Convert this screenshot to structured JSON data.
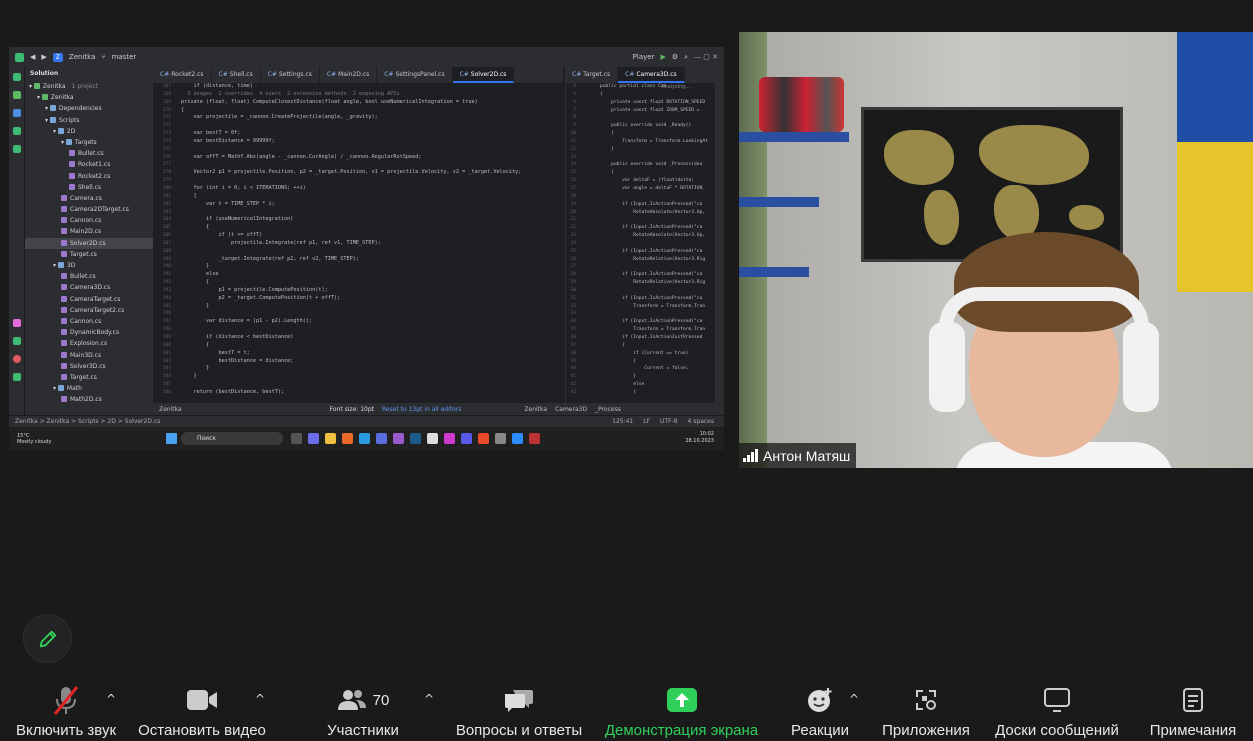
{
  "ide": {
    "project": "Zenitka",
    "branch": "master",
    "run_config": "Player",
    "solution_title": "Solution",
    "tree": [
      {
        "label": "Zenitka",
        "note": "1 project",
        "indent": 0,
        "type": "proj"
      },
      {
        "label": "Zenitka",
        "note": "",
        "indent": 1,
        "type": "proj"
      },
      {
        "label": "Dependencies",
        "note": "",
        "indent": 2,
        "type": "folder"
      },
      {
        "label": "Scripts",
        "note": "",
        "indent": 2,
        "type": "folder"
      },
      {
        "label": "2D",
        "note": "",
        "indent": 3,
        "type": "folder"
      },
      {
        "label": "Targets",
        "note": "",
        "indent": 4,
        "type": "folder"
      },
      {
        "label": "Bullet.cs",
        "note": "",
        "indent": 5,
        "type": "cs"
      },
      {
        "label": "Rocket1.cs",
        "note": "",
        "indent": 5,
        "type": "cs"
      },
      {
        "label": "Rocket2.cs",
        "note": "",
        "indent": 5,
        "type": "cs"
      },
      {
        "label": "Shell.cs",
        "note": "",
        "indent": 5,
        "type": "cs"
      },
      {
        "label": "Camera.cs",
        "note": "",
        "indent": 4,
        "type": "cs"
      },
      {
        "label": "Camera2DTarget.cs",
        "note": "",
        "indent": 4,
        "type": "cs"
      },
      {
        "label": "Cannon.cs",
        "note": "",
        "indent": 4,
        "type": "cs"
      },
      {
        "label": "Main2D.cs",
        "note": "",
        "indent": 4,
        "type": "cs"
      },
      {
        "label": "Solver2D.cs",
        "note": "",
        "indent": 4,
        "type": "cs",
        "selected": true
      },
      {
        "label": "Target.cs",
        "note": "",
        "indent": 4,
        "type": "cs"
      },
      {
        "label": "3D",
        "note": "",
        "indent": 3,
        "type": "folder"
      },
      {
        "label": "Bullet.cs",
        "note": "",
        "indent": 4,
        "type": "cs"
      },
      {
        "label": "Camera3D.cs",
        "note": "",
        "indent": 4,
        "type": "cs"
      },
      {
        "label": "CameraTarget.cs",
        "note": "",
        "indent": 4,
        "type": "cs"
      },
      {
        "label": "CameraTarget2.cs",
        "note": "",
        "indent": 4,
        "type": "cs"
      },
      {
        "label": "Cannon.cs",
        "note": "",
        "indent": 4,
        "type": "cs"
      },
      {
        "label": "DynamicBody.cs",
        "note": "",
        "indent": 4,
        "type": "cs"
      },
      {
        "label": "Explosion.cs",
        "note": "",
        "indent": 4,
        "type": "cs"
      },
      {
        "label": "Main3D.cs",
        "note": "",
        "indent": 4,
        "type": "cs"
      },
      {
        "label": "Solver3D.cs",
        "note": "",
        "indent": 4,
        "type": "cs"
      },
      {
        "label": "Target.cs",
        "note": "",
        "indent": 4,
        "type": "cs"
      },
      {
        "label": "Math",
        "note": "",
        "indent": 3,
        "type": "folder"
      },
      {
        "label": "Math2D.cs",
        "note": "",
        "indent": 4,
        "type": "cs"
      }
    ],
    "tabs": [
      "Rocket2.cs",
      "Shell.cs",
      "Settings.cs",
      "Main2D.cs",
      "SettingsPanel.cs",
      "Solver2D.cs"
    ],
    "active_tab": "Solver2D.cs",
    "tabs_right": [
      "Target.cs",
      "Camera3D.cs"
    ],
    "gutter_start": 167,
    "code_lines": [
      "    if (distance, time)",
      "  3 usages  2 overrides  4 users  2 extension methods  2 exposing APIs",
      "private (float, float) ComputeClosestDistance(float angle, bool useNumericalIntegration = true)",
      "{",
      "    var projectile = _cannon.CreateProjectile(angle, _gravity);",
      "",
      "    var bestT = 0f;",
      "    var bestDistance = 99999f;",
      "",
      "    var offT = Mathf.Abs(angle - _cannon.CurAngle) / _cannon.AngularRotSpeed;",
      "",
      "    Vector2 p1 = projectile.Position, p2 = _target.Position, v1 = projectile.Velocity, v2 = _target.Velocity;",
      "",
      "    for (int i = 0; i < ITERATIONS; ++i)",
      "    {",
      "        var t = TIME_STEP * i;",
      "",
      "        if (useNumericalIntegration)",
      "        {",
      "            if (t >= offT)",
      "                projectile.Integrate(ref p1, ref v1, TIME_STEP);",
      "",
      "            _target.Integrate(ref p2, ref v2, TIME_STEP);",
      "        }",
      "        else",
      "        {",
      "            p1 = projectile.ComputePosition(t);",
      "            p2 = _target.ComputePosition(t + offT);",
      "        }",
      "",
      "        var distance = (p1 - p2).Length();",
      "",
      "        if (distance < bestDistance)",
      "        {",
      "            bestT = t;",
      "            bestDistance = distance;",
      "        }",
      "    }",
      "",
      "    return (bestDistance, bestT);"
    ],
    "code2_lines": [
      "public partial class Cam",
      "{",
      "    private const float ROTATION_SPEED",
      "    private const float ZOOM_SPEED =",
      "",
      "    public override void _Ready()",
      "    {",
      "        Transform = Transform.LookingAt",
      "    }",
      "",
      "    public override void _Process(dou",
      "    {",
      "        var deltaF = (float)delta;",
      "        var angle = deltaF * ROTATION_",
      "",
      "        if (Input.IsActionPressed(\"ca",
      "            RotateAbsolute(Vector3.Up,",
      "",
      "        if (Input.IsActionPressed(\"ca",
      "            RotateAbsolute(Vector3.Up,",
      "",
      "        if (Input.IsActionPressed(\"ca",
      "            RotateRelative(Vector3.Rig",
      "",
      "        if (Input.IsActionPressed(\"ca",
      "            RotateRelative(Vector3.Rig",
      "",
      "        if (Input.IsActionPressed(\"ca",
      "            Transform = Transform.Tran",
      "",
      "        if (Input.IsActionPressed(\"ca",
      "            Transform = Transform.Tran",
      "        if (Input.IsActionJustPressed",
      "        {",
      "            if (Current == true)",
      "            {",
      "                Current = false;",
      "            }",
      "            else",
      "            {"
    ],
    "analyzing": "Analyzing...",
    "foot_left": "Zenitka",
    "font_size": "Font size: 10pt",
    "reset_link": "Reset to 13pt in all editors",
    "foot_right": "Zenitka",
    "foot_right2": "Camera3D",
    "foot_right3": "_Process",
    "breadcrumb": "Zenitka > Zenitka > Scripts > 2D > Solver2D.cs",
    "cursor_pos": "125:41",
    "line_ending": "LF",
    "encoding": "UTF-8",
    "indent": "4 spaces"
  },
  "taskbar": {
    "temp": "15°C",
    "weather": "Mostly cloudy",
    "search": "Поиск",
    "time": "10:02",
    "date": "28.10.2023"
  },
  "participant": {
    "name": "Антон Матяш"
  },
  "toolbar": {
    "mute": "Включить звук",
    "video": "Остановить видео",
    "participants": "Участники",
    "participants_count": "70",
    "qa": "Вопросы и ответы",
    "share": "Демонстрация экрана",
    "reactions": "Реакции",
    "apps": "Приложения",
    "whiteboards": "Доски сообщений",
    "notes": "Примечания",
    "share_color": "#2fd05a"
  }
}
